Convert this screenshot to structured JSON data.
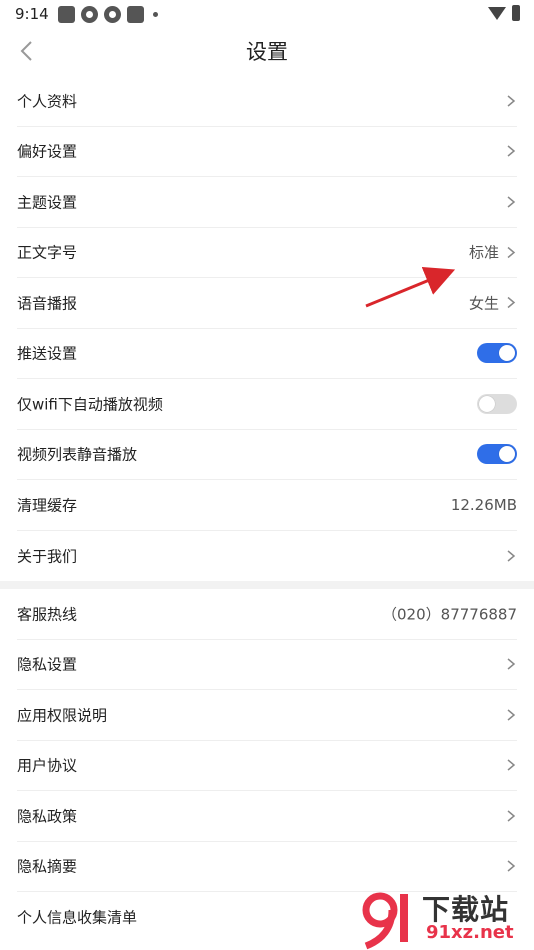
{
  "status_bar": {
    "time": "9:14"
  },
  "nav": {
    "title": "设置"
  },
  "group1": [
    {
      "label": "个人资料",
      "value": "",
      "control": "chevron"
    },
    {
      "label": "偏好设置",
      "value": "",
      "control": "chevron"
    },
    {
      "label": "主题设置",
      "value": "",
      "control": "chevron"
    },
    {
      "label": "正文字号",
      "value": "标准",
      "control": "chevron"
    },
    {
      "label": "语音播报",
      "value": "女生",
      "control": "chevron"
    },
    {
      "label": "推送设置",
      "value": "",
      "control": "toggle",
      "on": true
    },
    {
      "label": "仅wifi下自动播放视频",
      "value": "",
      "control": "toggle",
      "on": false
    },
    {
      "label": "视频列表静音播放",
      "value": "",
      "control": "toggle",
      "on": true
    },
    {
      "label": "清理缓存",
      "value": "12.26MB",
      "control": "none"
    },
    {
      "label": "关于我们",
      "value": "",
      "control": "chevron"
    }
  ],
  "group2": [
    {
      "label": "客服热线",
      "value": "（020）87776887",
      "control": "none"
    },
    {
      "label": "隐私设置",
      "value": "",
      "control": "chevron"
    },
    {
      "label": "应用权限说明",
      "value": "",
      "control": "chevron"
    },
    {
      "label": "用户协议",
      "value": "",
      "control": "chevron"
    },
    {
      "label": "隐私政策",
      "value": "",
      "control": "chevron"
    },
    {
      "label": "隐私摘要",
      "value": "",
      "control": "chevron"
    },
    {
      "label": "个人信息收集清单",
      "value": "",
      "control": "none"
    }
  ],
  "watermark": {
    "title": "下载站",
    "site": "91xz.net"
  },
  "colors": {
    "accent": "#2f6ee8",
    "annotation_arrow": "#d9262b",
    "watermark_red": "#e8334a"
  }
}
